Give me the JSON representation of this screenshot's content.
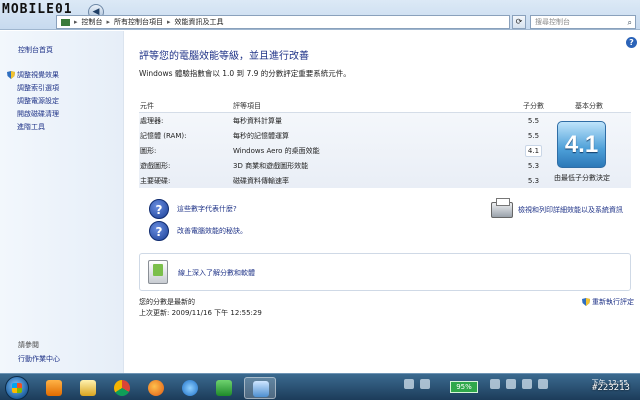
{
  "watermark_logo": "MOBILE01",
  "address_bar": {
    "path": [
      "控制台",
      "所有控制台項目",
      "效能資訊及工具"
    ],
    "search_placeholder": "搜尋控制台"
  },
  "sidebar": {
    "home": "控制台首頁",
    "items": [
      {
        "label": "調整視覺效果",
        "shield": true
      },
      {
        "label": "調整索引選項",
        "shield": false
      },
      {
        "label": "調整電源設定",
        "shield": false
      },
      {
        "label": "開啟磁碟清理",
        "shield": false
      },
      {
        "label": "進階工具",
        "shield": false
      }
    ],
    "see_also": "請參閱",
    "action_center": "行動作業中心"
  },
  "main": {
    "title": "評等您的電腦效能等級，並且進行改善",
    "subtitle": "Windows 體驗指數會以 1.0 到 7.9 的分數評定重要系統元件。",
    "table": {
      "headers": [
        "元件",
        "評等項目",
        "子分數",
        "基本分數"
      ],
      "rows": [
        {
          "component": "處理器:",
          "rated": "每秒資料計算量",
          "subscore": "5.5"
        },
        {
          "component": "記憶體 (RAM):",
          "rated": "每秒的記憶體運算",
          "subscore": "5.5"
        },
        {
          "component": "圖形:",
          "rated": "Windows Aero 的桌面效能",
          "subscore": "4.1"
        },
        {
          "component": "遊戲圖形:",
          "rated": "3D 商業和遊戲圖形效能",
          "subscore": "5.3"
        },
        {
          "component": "主要硬碟:",
          "rated": "磁碟資料傳輸速率",
          "subscore": "5.3"
        }
      ],
      "base_score": "4.1",
      "base_caption": "由最低子分數決定"
    },
    "links": {
      "what_numbers": "這些數字代表什麼?",
      "tips": "改善電腦效能的秘訣。",
      "print": "檢視和列印詳細效能以及系統資訊"
    },
    "info_box": "線上深入了解分數和軟體",
    "latest": "您的分數是最新的",
    "last_update": "上次更新: 2009/11/16 下午 12:55:29",
    "rerun": "重新執行評定"
  },
  "taskbar": {
    "battery": "95%",
    "time": "下午 12:55",
    "date": "#223213"
  }
}
